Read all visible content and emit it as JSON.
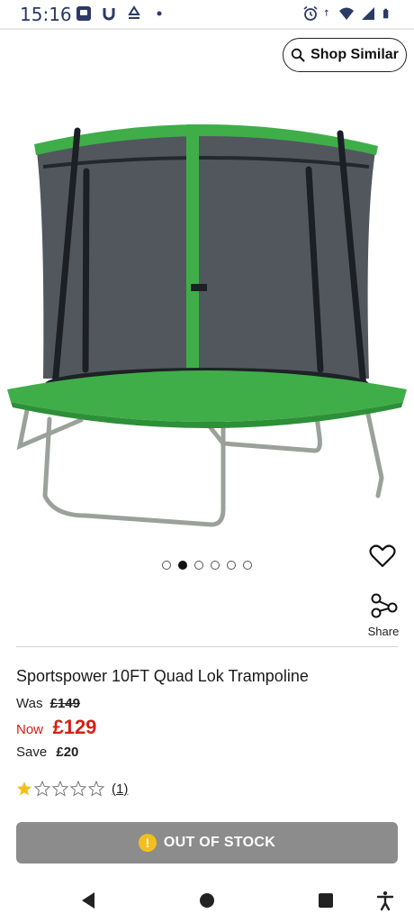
{
  "status_bar": {
    "time": "15:16",
    "left_icons": [
      "sim-card-icon",
      "notification-u-icon",
      "recycle-icon",
      "dot-icon"
    ],
    "right_icons": [
      "alarm-icon",
      "data-arrows-icon",
      "wifi-icon",
      "signal-icon",
      "battery-icon"
    ]
  },
  "shop_similar": {
    "label": "Shop Similar",
    "icon": "search-icon"
  },
  "carousel": {
    "total": 6,
    "active_index": 1
  },
  "actions": {
    "share_label": "Share"
  },
  "product": {
    "title": "Sportspower 10FT Quad Lok Trampoline",
    "was_label": "Was",
    "was_price": "£149",
    "now_label": "Now",
    "now_price": "£129",
    "save_label": "Save",
    "save_amount": "£20",
    "rating": 1,
    "rating_max": 5,
    "review_count": "(1)"
  },
  "stock_button": {
    "label": "OUT OF STOCK",
    "icon": "!"
  },
  "colors": {
    "price_red": "#d42114",
    "star_gold": "#f4bf1e",
    "button_grey": "#8c8c8c",
    "trampoline_green": "#3fae49"
  },
  "nav_bar": {
    "icons": [
      "back-icon",
      "home-icon",
      "recents-icon",
      "accessibility-icon"
    ]
  }
}
